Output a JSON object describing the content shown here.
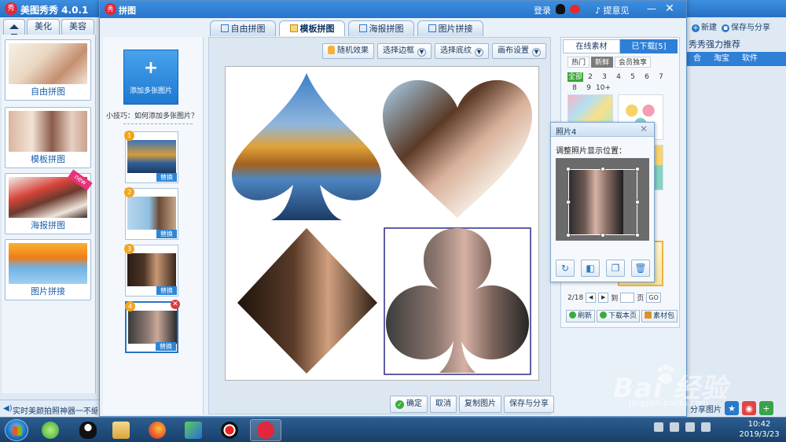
{
  "app": {
    "title": "美图秀秀 4.0.1",
    "logo_text": "秀",
    "tabs": [
      {
        "label": ""
      },
      {
        "label": "美化"
      },
      {
        "label": "美容"
      }
    ],
    "modes": [
      {
        "label": "自由拼图"
      },
      {
        "label": "模板拼图"
      },
      {
        "label": "海报拼图",
        "badge": "new"
      },
      {
        "label": "图片拼接"
      }
    ],
    "status_text": "实时美颜拍照神器一不缩图",
    "right": {
      "new_label": "新建",
      "save_share_label": "保存与分享",
      "recommend": "秀秀强力推荐",
      "tabs": [
        "合",
        "淘宝",
        "软件"
      ],
      "share_label": "分享图片"
    }
  },
  "dialog": {
    "title": "拼图",
    "logo_text": "秀",
    "login": "登录",
    "feedback": "提意见",
    "minimize": "—",
    "close": "✕",
    "tabs": [
      {
        "label": "自由拼图"
      },
      {
        "label": "模板拼图",
        "active": true
      },
      {
        "label": "海报拼图"
      },
      {
        "label": "图片拼接"
      }
    ],
    "add_button": {
      "plus": "+",
      "label": "添加多张图片"
    },
    "tip": "小技巧：如何添加多张图片？",
    "thumbnails": [
      {
        "num": "1",
        "replace": "替换"
      },
      {
        "num": "2",
        "replace": "替换"
      },
      {
        "num": "3",
        "replace": "替换"
      },
      {
        "num": "4",
        "replace": "替换",
        "delete": "✕"
      }
    ],
    "toolbar": {
      "random": "随机效果",
      "border": "选择边框",
      "texture": "选择底纹",
      "canvas": "画布设置"
    },
    "bottom": {
      "confirm": "确定",
      "cancel": "取消",
      "copy": "复制图片",
      "save": "保存与分享"
    },
    "material": {
      "tabs": [
        "在线素材",
        "已下载[5]"
      ],
      "filters": [
        "热门",
        "新鲜",
        "会员独享"
      ],
      "pages": [
        "全部",
        "2",
        "3",
        "4",
        "5",
        "6",
        "7",
        "8",
        "9",
        "10+"
      ],
      "pager": {
        "current": "2/18",
        "prev": "◀",
        "next": "▶",
        "to": "到",
        "page": "页",
        "go": "GO"
      },
      "actions": [
        "刷新",
        "下载本页",
        "素材包"
      ]
    },
    "popup": {
      "title": "照片4",
      "close": "✕",
      "label": "调整照片显示位置：",
      "tools": [
        "↻",
        "◧",
        "❐",
        "🗑"
      ]
    }
  },
  "taskbar": {
    "time": "10:42",
    "date": "2019/3/23"
  },
  "watermark": {
    "text": "Bai  经验",
    "url": "jingyan.baidu.com"
  },
  "colors": {
    "titlebar": "#2a74c8",
    "accent": "#2e7fd6",
    "active_green": "#37a437",
    "badge_orange": "#f4a51c"
  }
}
